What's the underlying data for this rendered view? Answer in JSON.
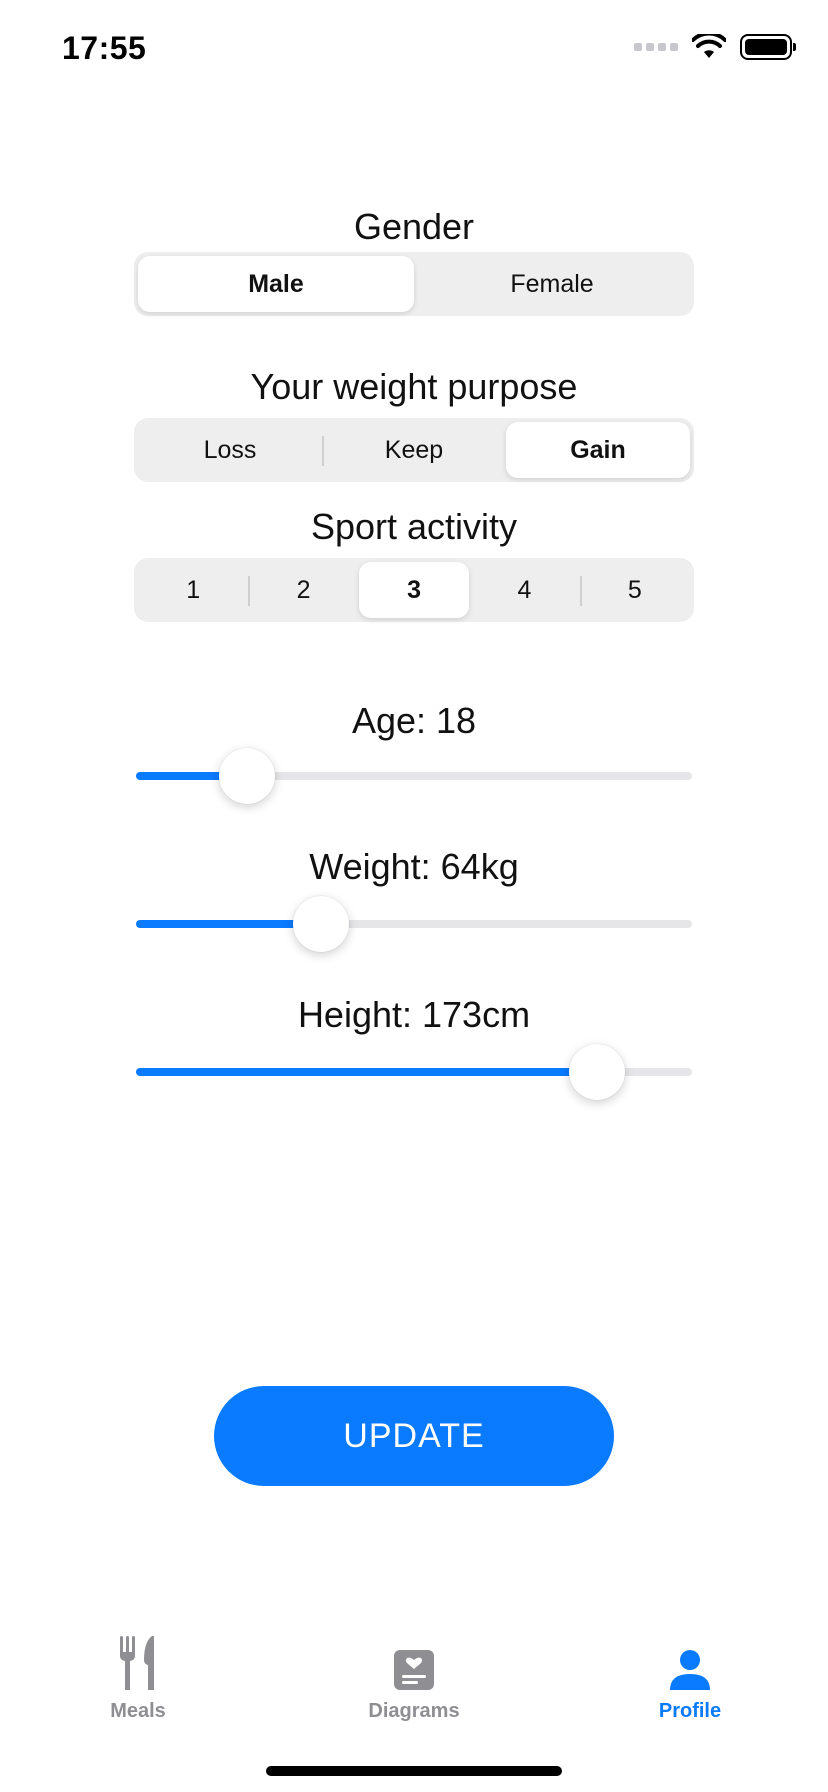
{
  "status_bar": {
    "time": "17:55"
  },
  "gender": {
    "title": "Gender",
    "options": [
      "Male",
      "Female"
    ],
    "selected": "Male"
  },
  "weight_purpose": {
    "title": "Your weight purpose",
    "options": [
      "Loss",
      "Keep",
      "Gain"
    ],
    "selected": "Gain"
  },
  "sport_activity": {
    "title": "Sport activity",
    "options": [
      "1",
      "2",
      "3",
      "4",
      "5"
    ],
    "selected": "3"
  },
  "sliders": {
    "age": {
      "label": "Age: 18",
      "fraction": 0.2
    },
    "weight": {
      "label": "Weight: 64kg",
      "fraction": 0.333
    },
    "height": {
      "label": "Height: 173cm",
      "fraction": 0.83
    }
  },
  "update_button": {
    "label": "UPDATE"
  },
  "tabbar": {
    "meals": {
      "label": "Meals",
      "icon": "fork-knife-icon"
    },
    "diagrams": {
      "label": "Diagrams",
      "icon": "heart-note-icon"
    },
    "profile": {
      "label": "Profile",
      "icon": "person-icon"
    },
    "active": "profile"
  },
  "colors": {
    "accent": "#0a7aff",
    "inactive": "#8e8e93"
  }
}
